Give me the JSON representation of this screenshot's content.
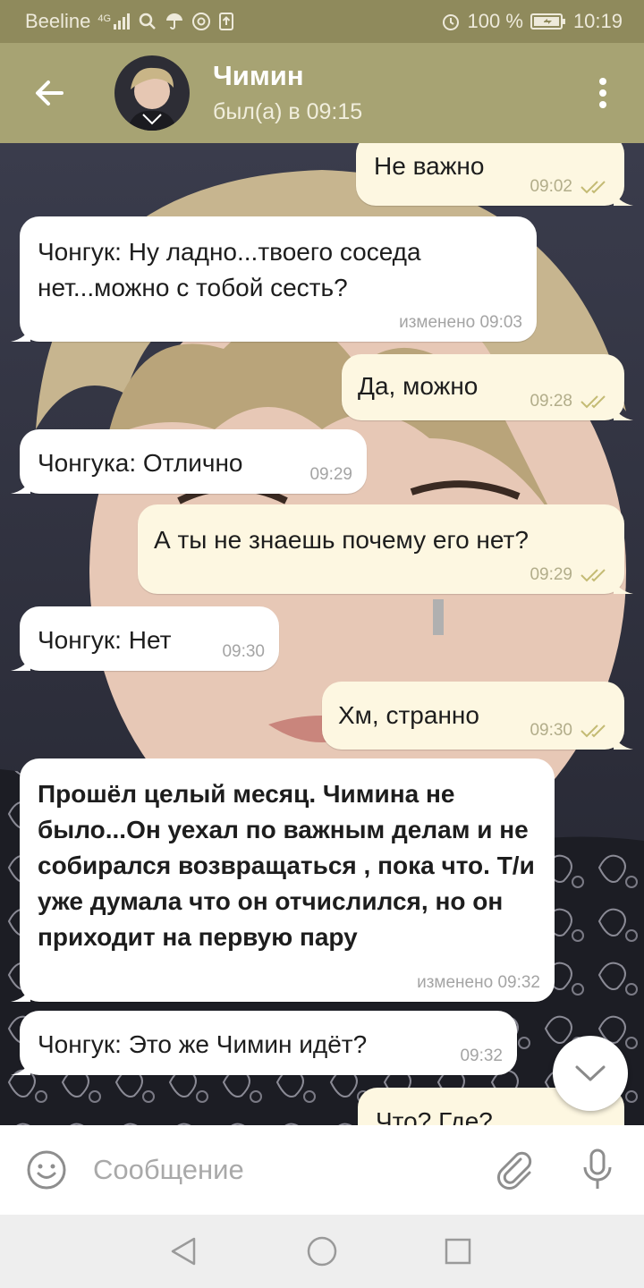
{
  "status_bar": {
    "carrier": "Beeline",
    "network": "4G",
    "battery": "100 %",
    "time": "10:19"
  },
  "header": {
    "contact_name": "Чимин",
    "last_seen": "был(а) в 09:15"
  },
  "messages": [
    {
      "direction": "out",
      "text": "Не важно",
      "time": "09:02",
      "read": true
    },
    {
      "direction": "in",
      "text": "Чонгук: Ну ладно...твоего  соседа нет...можно с тобой сесть?",
      "time": "изменено 09:03"
    },
    {
      "direction": "out",
      "text": "Да, можно",
      "time": "09:28",
      "read": true
    },
    {
      "direction": "in",
      "text": "Чонгука: Отлично",
      "time": "09:29"
    },
    {
      "direction": "out",
      "text": "А ты не знаешь почему его нет?",
      "time": "09:29",
      "read": true
    },
    {
      "direction": "in",
      "text": "Чонгук: Нет",
      "time": "09:30"
    },
    {
      "direction": "out",
      "text": "Хм, странно",
      "time": "09:30",
      "read": true
    },
    {
      "direction": "in",
      "text": "Прошёл целый месяц. Чимина не было...Он уехал по важным делам и не собирался возвращаться , пока что. Т/и уже думала что он отчислился, но он приходит на первую пару",
      "time": "изменено 09:32",
      "bold": true
    },
    {
      "direction": "in",
      "text": "Чонгук: Это же Чимин идёт?",
      "time": "09:32"
    },
    {
      "direction": "out",
      "text": "Что? Где?",
      "time": "",
      "read": true
    }
  ],
  "composer": {
    "placeholder": "Сообщение"
  },
  "icons": {
    "back": "arrow-left-icon",
    "menu": "more-vertical-icon",
    "emoji": "smiley-icon",
    "attach": "paperclip-icon",
    "mic": "microphone-icon",
    "scroll": "chevron-down-icon",
    "nav": [
      "back-triangle-icon",
      "home-circle-icon",
      "recents-square-icon"
    ]
  },
  "colors": {
    "toolbar": "#a7a373",
    "status_bar": "#8f8a5c",
    "outgoing_bubble": "#fdf7e1",
    "incoming_bubble": "#ffffff",
    "read_checks": "#c4bb74"
  }
}
